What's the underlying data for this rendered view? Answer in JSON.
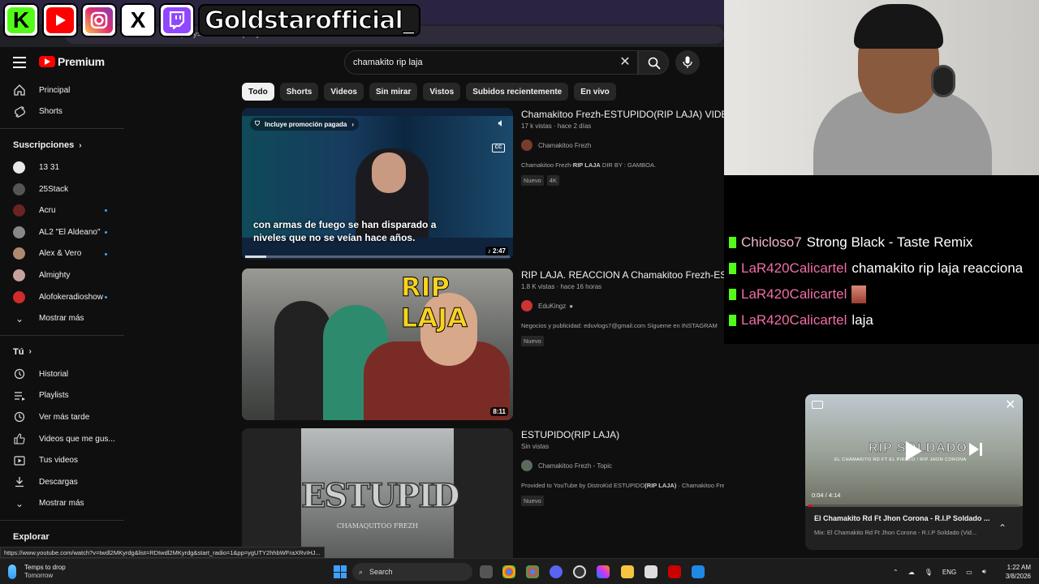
{
  "browser": {
    "url_fragment": "query=chamakito+rip+laja"
  },
  "overlay": {
    "handle": "Goldstarofficial_",
    "socials": [
      "kick-icon",
      "youtube-icon",
      "instagram-icon",
      "x-icon",
      "twitch-icon"
    ]
  },
  "header": {
    "brand": "Premium",
    "search_value": "chamakito rip laja"
  },
  "sidebar": {
    "primary": [
      {
        "label": "Principal",
        "icon": "home-icon"
      },
      {
        "label": "Shorts",
        "icon": "shorts-icon"
      }
    ],
    "subs_title": "Suscripciones",
    "subs": [
      {
        "label": "13 31",
        "color": "#e8e8e8",
        "dot": false
      },
      {
        "label": "25Stack",
        "color": "#555555",
        "dot": false
      },
      {
        "label": "Acru",
        "color": "#6a2323",
        "dot": true
      },
      {
        "label": "AL2 \"El Aldeano\"",
        "color": "#888888",
        "dot": true
      },
      {
        "label": "Alex & Vero",
        "color": "#b08a70",
        "dot": true
      },
      {
        "label": "Almighty",
        "color": "#c9a0a0",
        "dot": false
      },
      {
        "label": "Alofokeradioshow",
        "color": "#d12b2b",
        "dot": true
      }
    ],
    "show_more": "Mostrar más",
    "you_title": "Tú",
    "you": [
      {
        "label": "Historial",
        "icon": "history-icon"
      },
      {
        "label": "Playlists",
        "icon": "playlists-icon"
      },
      {
        "label": "Ver más tarde",
        "icon": "watch-later-icon"
      },
      {
        "label": "Videos que me gus...",
        "icon": "like-icon"
      },
      {
        "label": "Tus videos",
        "icon": "your-videos-icon"
      },
      {
        "label": "Descargas",
        "icon": "download-icon"
      }
    ],
    "show_more2": "Mostrar más",
    "explore_title": "Explorar"
  },
  "chips": [
    "Todo",
    "Shorts",
    "Videos",
    "Sin mirar",
    "Vistos",
    "Subidos recientemente",
    "En vivo"
  ],
  "results": [
    {
      "title": "Chamakitoo Frezh-ESTUPIDO(RIP LAJA) VIDEO",
      "meta": "17 k vistas · hace 2 días",
      "channel": "Chamakitoo Frezh",
      "desc_pre": "Chamakitoo Frezh-",
      "desc_bold": "RIP LAJA",
      "desc_post": " DIR BY : GAMBOA.",
      "badges": [
        "Nuevo",
        "4K"
      ],
      "duration": "2:47",
      "promo": "Incluye promoción pagada",
      "caption1": "con armas de fuego se han disparado a",
      "caption2": "niveles que no se veían hace años.",
      "progress": 0.08
    },
    {
      "title": "RIP LAJA. REACCION A Chamakitoo Frezh-ESTUPIDO",
      "meta": "1.8 K vistas · hace 16 horas",
      "channel": "EduKingz",
      "desc_pre": "Negocios y publicidad: eduvlogs7@gmail.com Sígueme en INSTAGRAM",
      "desc_bold": "",
      "desc_post": "",
      "badges": [
        "Nuevo"
      ],
      "duration": "8:11",
      "thumb_text": "RIP LAJA"
    },
    {
      "title": "ESTUPIDO(RIP LAJA)",
      "meta": "Sin vistas",
      "channel": "Chamakitoo Frezh - Topic",
      "desc_pre": "Provided to YouTube by DistroKid ESTUPIDO",
      "desc_bold": "(RIP LAJA)",
      "desc_post": " · Chamakitoo Frezh · Chamakitoo Frezh ESTUPIDO",
      "badges": [
        "Nuevo"
      ],
      "thumb_text": "ESTUPID",
      "thumb_sub": "CHAMAQUITOO FREZH"
    }
  ],
  "status_url": "https://www.youtube.com/watch?v=twdl2MKyrdg&list=RDtwdl2MKyrdg&start_radio=1&pp=ygUTY2hhbWFraXRvIHJ...",
  "chat": [
    {
      "user": "Chicloso7",
      "color": "#f5b6c8",
      "text": "Strong Black - Taste Remix"
    },
    {
      "user": "LaR420Calicartel",
      "color": "#f06ea5",
      "text": "chamakito rip laja reacciona"
    },
    {
      "user": "LaR420Calicartel",
      "color": "#f06ea5",
      "text": ""
    },
    {
      "user": "LaR420Calicartel",
      "color": "#f06ea5",
      "text": "laja"
    }
  ],
  "mini_player": {
    "watermark": "RIP SOLDADO",
    "watermark_sub": "EL CHAMAKITO RD FT EL PIRULO / RIP JHON CORONA",
    "time": "0:04 / 4:14",
    "progress": 0.016,
    "title": "El Chamakito Rd Ft Jhon Corona - R.I.P Soldado ...",
    "subtitle": "Mix: El Chamakito Rd Ft Jhon Corona - R.I.P Soldado (Vid..."
  },
  "taskbar": {
    "weather_title": "Temps to drop",
    "weather_sub": "Tomorrow",
    "search": "Search",
    "lang": "ENG",
    "time": "1:22 AM",
    "date": "3/8/2026"
  }
}
